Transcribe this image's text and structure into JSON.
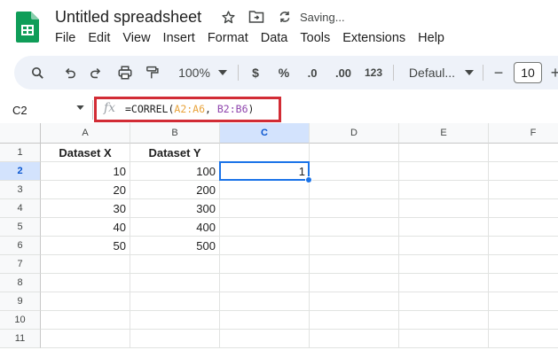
{
  "app": {
    "doc_title": "Untitled spreadsheet",
    "save_status": "Saving...",
    "brand_color": "#0f9d58",
    "accent_color": "#1a73e8",
    "highlight_color": "#d22c35"
  },
  "menu": [
    "File",
    "Edit",
    "View",
    "Insert",
    "Format",
    "Data",
    "Tools",
    "Extensions",
    "Help"
  ],
  "toolbar": {
    "zoom": "100%",
    "currency": "$",
    "percent": "%",
    "decrease_decimal": ".0",
    "increase_decimal": ".00",
    "number_format": "123",
    "font": "Defaul...",
    "font_size": "10",
    "minus": "−",
    "plus": "+"
  },
  "formula_bar": {
    "name_box": "C2",
    "fx": "fx",
    "formula_prefix": "=CORREL(",
    "range1": "A2:A6",
    "sep": ", ",
    "range2": "B2:B6",
    "formula_suffix": ")"
  },
  "sheet": {
    "columns": [
      "A",
      "B",
      "C",
      "D",
      "E",
      "F"
    ],
    "rows": [
      "1",
      "2",
      "3",
      "4",
      "5",
      "6",
      "7",
      "8",
      "9",
      "10",
      "11"
    ],
    "selected_cell": "C2",
    "cells": {
      "A1": "Dataset X",
      "B1": "Dataset Y",
      "A2": "10",
      "B2": "100",
      "C2": "1",
      "A3": "20",
      "B3": "200",
      "A4": "30",
      "B4": "300",
      "A5": "40",
      "B5": "400",
      "A6": "50",
      "B6": "500"
    }
  }
}
